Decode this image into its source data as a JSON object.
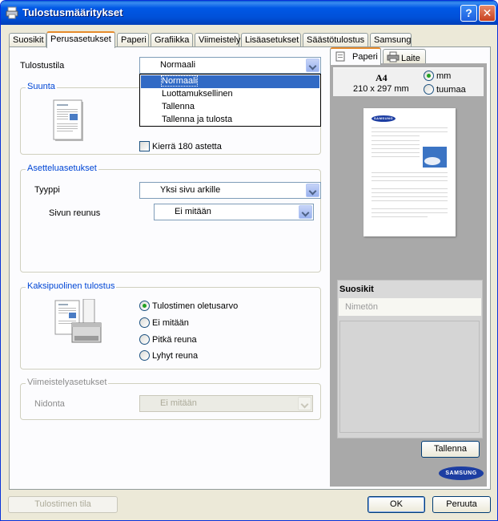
{
  "window": {
    "title": "Tulostusmääritykset"
  },
  "tabs": [
    "Suosikit",
    "Perusasetukset",
    "Paperi",
    "Grafiikka",
    "Viimeistely",
    "Lisäasetukset",
    "Säästötulostus",
    "Samsung"
  ],
  "active_tab": "Perusasetukset",
  "print_mode": {
    "label": "Tulostustila",
    "value": "Normaali",
    "options": [
      "Normaali",
      "Luottamuksellinen",
      "Tallenna",
      "Tallenna ja tulosta"
    ]
  },
  "orientation": {
    "title": "Suunta",
    "rotate_label": "Kierrä 180 astetta",
    "rotate_checked": false
  },
  "layout": {
    "title": "Asetteluasetukset",
    "type_label": "Tyyppi",
    "type_value": "Yksi sivu arkille",
    "border_label": "Sivun reunus",
    "border_value": "Ei mitään"
  },
  "duplex": {
    "title": "Kaksipuolinen tulostus",
    "options": [
      "Tulostimen oletusarvo",
      "Ei mitään",
      "Pitkä reuna",
      "Lyhyt reuna"
    ],
    "selected": "Tulostimen oletusarvo"
  },
  "finishing": {
    "title": "Viimeistelyasetukset",
    "binding_label": "Nidonta",
    "binding_value": "Ei mitään"
  },
  "preview": {
    "tabs": [
      "Paperi",
      "Laite"
    ],
    "active_tab": "Paperi",
    "paper_size": "A4",
    "paper_dims": "210 x 297 mm",
    "units": [
      "mm",
      "tuumaa"
    ],
    "unit_selected": "mm",
    "page_logo": "SAMSUNG"
  },
  "favorites": {
    "title": "Suosikit",
    "name_placeholder": "Nimetön",
    "save_label": "Tallenna"
  },
  "brand_logo": "SAMSUNG",
  "footer": {
    "printer_status": "Tulostimen tila",
    "ok": "OK",
    "cancel": "Peruuta"
  }
}
